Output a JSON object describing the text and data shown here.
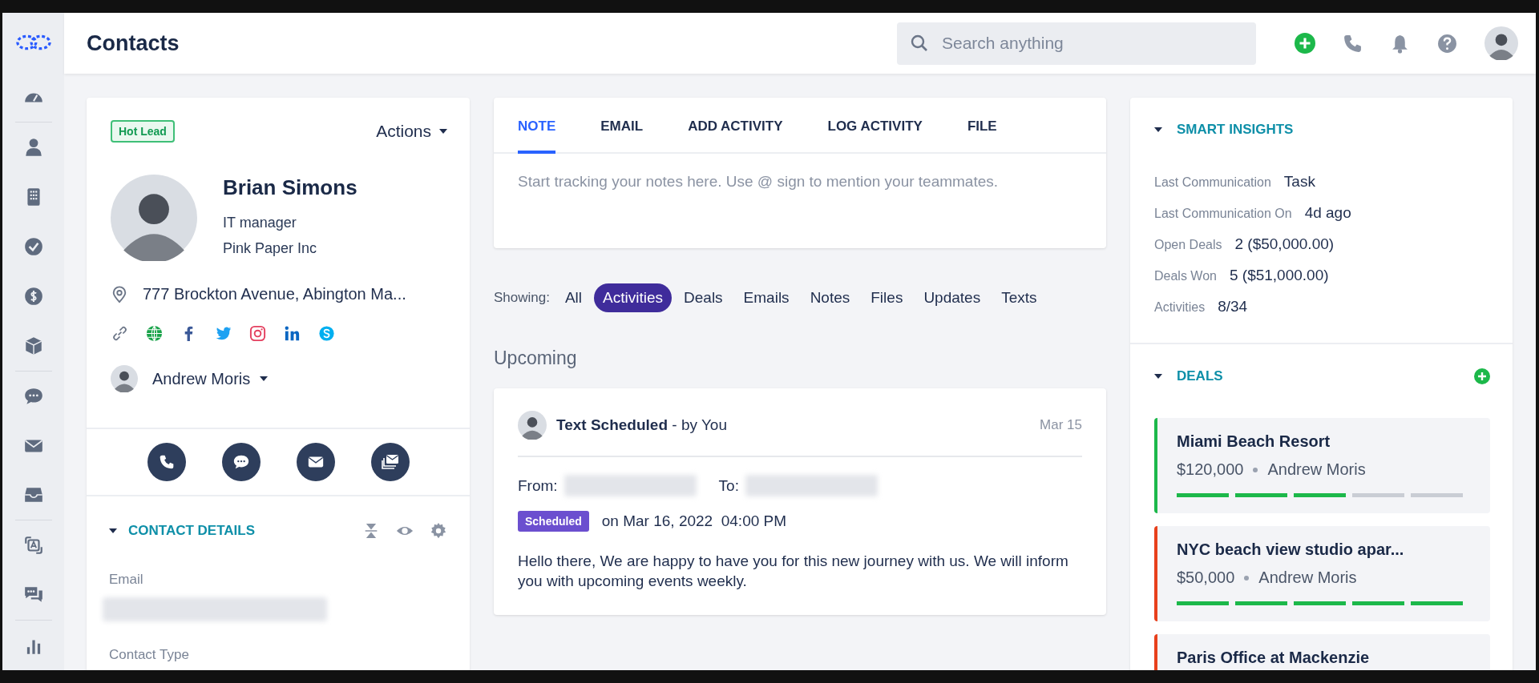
{
  "header": {
    "title": "Contacts",
    "search": {
      "placeholder": "Search anything"
    }
  },
  "contact": {
    "tag": "Hot Lead",
    "actions": "Actions",
    "name": "Brian Simons",
    "job_title": "IT manager",
    "company": "Pink Paper Inc",
    "address": "777 Brockton Avenue, Abington Ma...",
    "owner": "Andrew Moris"
  },
  "contact_details": {
    "title": "CONTACT DETAILS",
    "fields": [
      {
        "label": "Email",
        "blurred": true
      },
      {
        "label": "Contact Type",
        "blurred": false
      }
    ]
  },
  "composer": {
    "tabs": [
      {
        "label": "NOTE",
        "selected": true
      },
      {
        "label": "EMAIL",
        "selected": false
      },
      {
        "label": "ADD ACTIVITY",
        "selected": false
      },
      {
        "label": "LOG ACTIVITY",
        "selected": false
      },
      {
        "label": "FILE",
        "selected": false
      }
    ],
    "placeholder": "Start tracking your notes here. Use @ sign to mention your teammates."
  },
  "filter": {
    "label": "Showing:",
    "options": [
      {
        "label": "All",
        "selected": false
      },
      {
        "label": "Activities",
        "selected": true
      },
      {
        "label": "Deals",
        "selected": false
      },
      {
        "label": "Emails",
        "selected": false
      },
      {
        "label": "Notes",
        "selected": false
      },
      {
        "label": "Files",
        "selected": false
      },
      {
        "label": "Updates",
        "selected": false
      },
      {
        "label": "Texts",
        "selected": false
      }
    ]
  },
  "section_title": "Upcoming",
  "activity": {
    "title": "Text Scheduled",
    "by": "- by You",
    "date": "Mar 15",
    "from_label": "From:",
    "to_label": "To:",
    "status": "Scheduled",
    "when": "on Mar 16, 2022  04:00 PM",
    "message": "Hello there, We are happy to have you for this new journey with us. We will inform you with upcoming events weekly."
  },
  "insights": {
    "title": "SMART INSIGHTS",
    "rows": [
      {
        "label": "Last Communication",
        "value": "Task"
      },
      {
        "label": "Last Communication On",
        "value": "4d ago"
      },
      {
        "label": "Open Deals",
        "value": "2 ($50,000.00)"
      },
      {
        "label": "Deals Won",
        "value": "5 ($51,000.00)"
      },
      {
        "label": "Activities",
        "value": "8/34"
      }
    ]
  },
  "deals": {
    "title": "DEALS",
    "items": [
      {
        "name": "Miami Beach Resort",
        "amount": "$120,000",
        "owner": "Andrew Moris",
        "color": "#1cb84a",
        "level": 0.6
      },
      {
        "name": "NYC beach view studio apar...",
        "amount": "$50,000",
        "owner": "Andrew Moris",
        "color": "#e8401c",
        "level": 1
      },
      {
        "name": "Paris Office at Mackenzie",
        "color": "#e8401c"
      }
    ]
  }
}
